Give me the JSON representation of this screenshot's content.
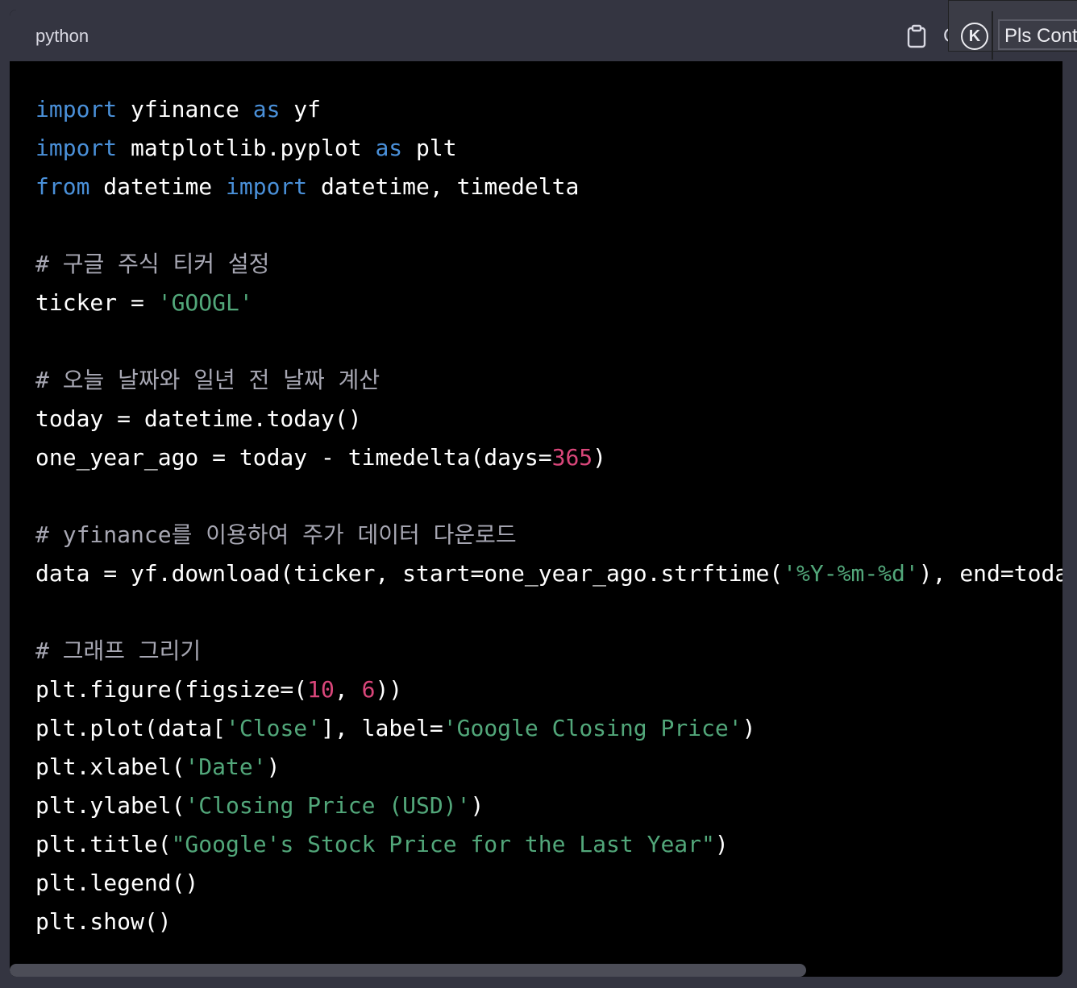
{
  "header": {
    "language": "python",
    "copy_label": "C",
    "extension": {
      "k_label": "K",
      "button_label": "Pls Cont"
    }
  },
  "colors": {
    "keyword": "#4a90d9",
    "string": "#52a77a",
    "number": "#d9467a",
    "comment": "#a7a7b3",
    "text": "#ffffff"
  },
  "code_lines": [
    [
      {
        "t": "kw",
        "v": "import"
      },
      {
        "t": "tx",
        "v": " yfinance "
      },
      {
        "t": "kw",
        "v": "as"
      },
      {
        "t": "tx",
        "v": " yf"
      }
    ],
    [
      {
        "t": "kw",
        "v": "import"
      },
      {
        "t": "tx",
        "v": " matplotlib.pyplot "
      },
      {
        "t": "kw",
        "v": "as"
      },
      {
        "t": "tx",
        "v": " plt"
      }
    ],
    [
      {
        "t": "kw",
        "v": "from"
      },
      {
        "t": "tx",
        "v": " datetime "
      },
      {
        "t": "kw",
        "v": "import"
      },
      {
        "t": "tx",
        "v": " datetime, timedelta"
      }
    ],
    [],
    [
      {
        "t": "cm",
        "v": "# 구글 주식 티커 설정"
      }
    ],
    [
      {
        "t": "tx",
        "v": "ticker = "
      },
      {
        "t": "str",
        "v": "'GOOGL'"
      }
    ],
    [],
    [
      {
        "t": "cm",
        "v": "# 오늘 날짜와 일년 전 날짜 계산"
      }
    ],
    [
      {
        "t": "tx",
        "v": "today = datetime.today()"
      }
    ],
    [
      {
        "t": "tx",
        "v": "one_year_ago = today - timedelta(days="
      },
      {
        "t": "num",
        "v": "365"
      },
      {
        "t": "tx",
        "v": ")"
      }
    ],
    [],
    [
      {
        "t": "cm",
        "v": "# yfinance를 이용하여 주가 데이터 다운로드"
      }
    ],
    [
      {
        "t": "tx",
        "v": "data = yf.download(ticker, start=one_year_ago.strftime("
      },
      {
        "t": "str",
        "v": "'%Y-%m-%d'"
      },
      {
        "t": "tx",
        "v": "), end=toda"
      }
    ],
    [],
    [
      {
        "t": "cm",
        "v": "# 그래프 그리기"
      }
    ],
    [
      {
        "t": "tx",
        "v": "plt.figure(figsize=("
      },
      {
        "t": "num",
        "v": "10"
      },
      {
        "t": "tx",
        "v": ", "
      },
      {
        "t": "num",
        "v": "6"
      },
      {
        "t": "tx",
        "v": "))"
      }
    ],
    [
      {
        "t": "tx",
        "v": "plt.plot(data["
      },
      {
        "t": "str",
        "v": "'Close'"
      },
      {
        "t": "tx",
        "v": "], label="
      },
      {
        "t": "str",
        "v": "'Google Closing Price'"
      },
      {
        "t": "tx",
        "v": ")"
      }
    ],
    [
      {
        "t": "tx",
        "v": "plt.xlabel("
      },
      {
        "t": "str",
        "v": "'Date'"
      },
      {
        "t": "tx",
        "v": ")"
      }
    ],
    [
      {
        "t": "tx",
        "v": "plt.ylabel("
      },
      {
        "t": "str",
        "v": "'Closing Price (USD)'"
      },
      {
        "t": "tx",
        "v": ")"
      }
    ],
    [
      {
        "t": "tx",
        "v": "plt.title("
      },
      {
        "t": "str",
        "v": "\"Google's Stock Price for the Last Year\""
      },
      {
        "t": "tx",
        "v": ")"
      }
    ],
    [
      {
        "t": "tx",
        "v": "plt.legend()"
      }
    ],
    [
      {
        "t": "tx",
        "v": "plt.show()"
      }
    ]
  ]
}
